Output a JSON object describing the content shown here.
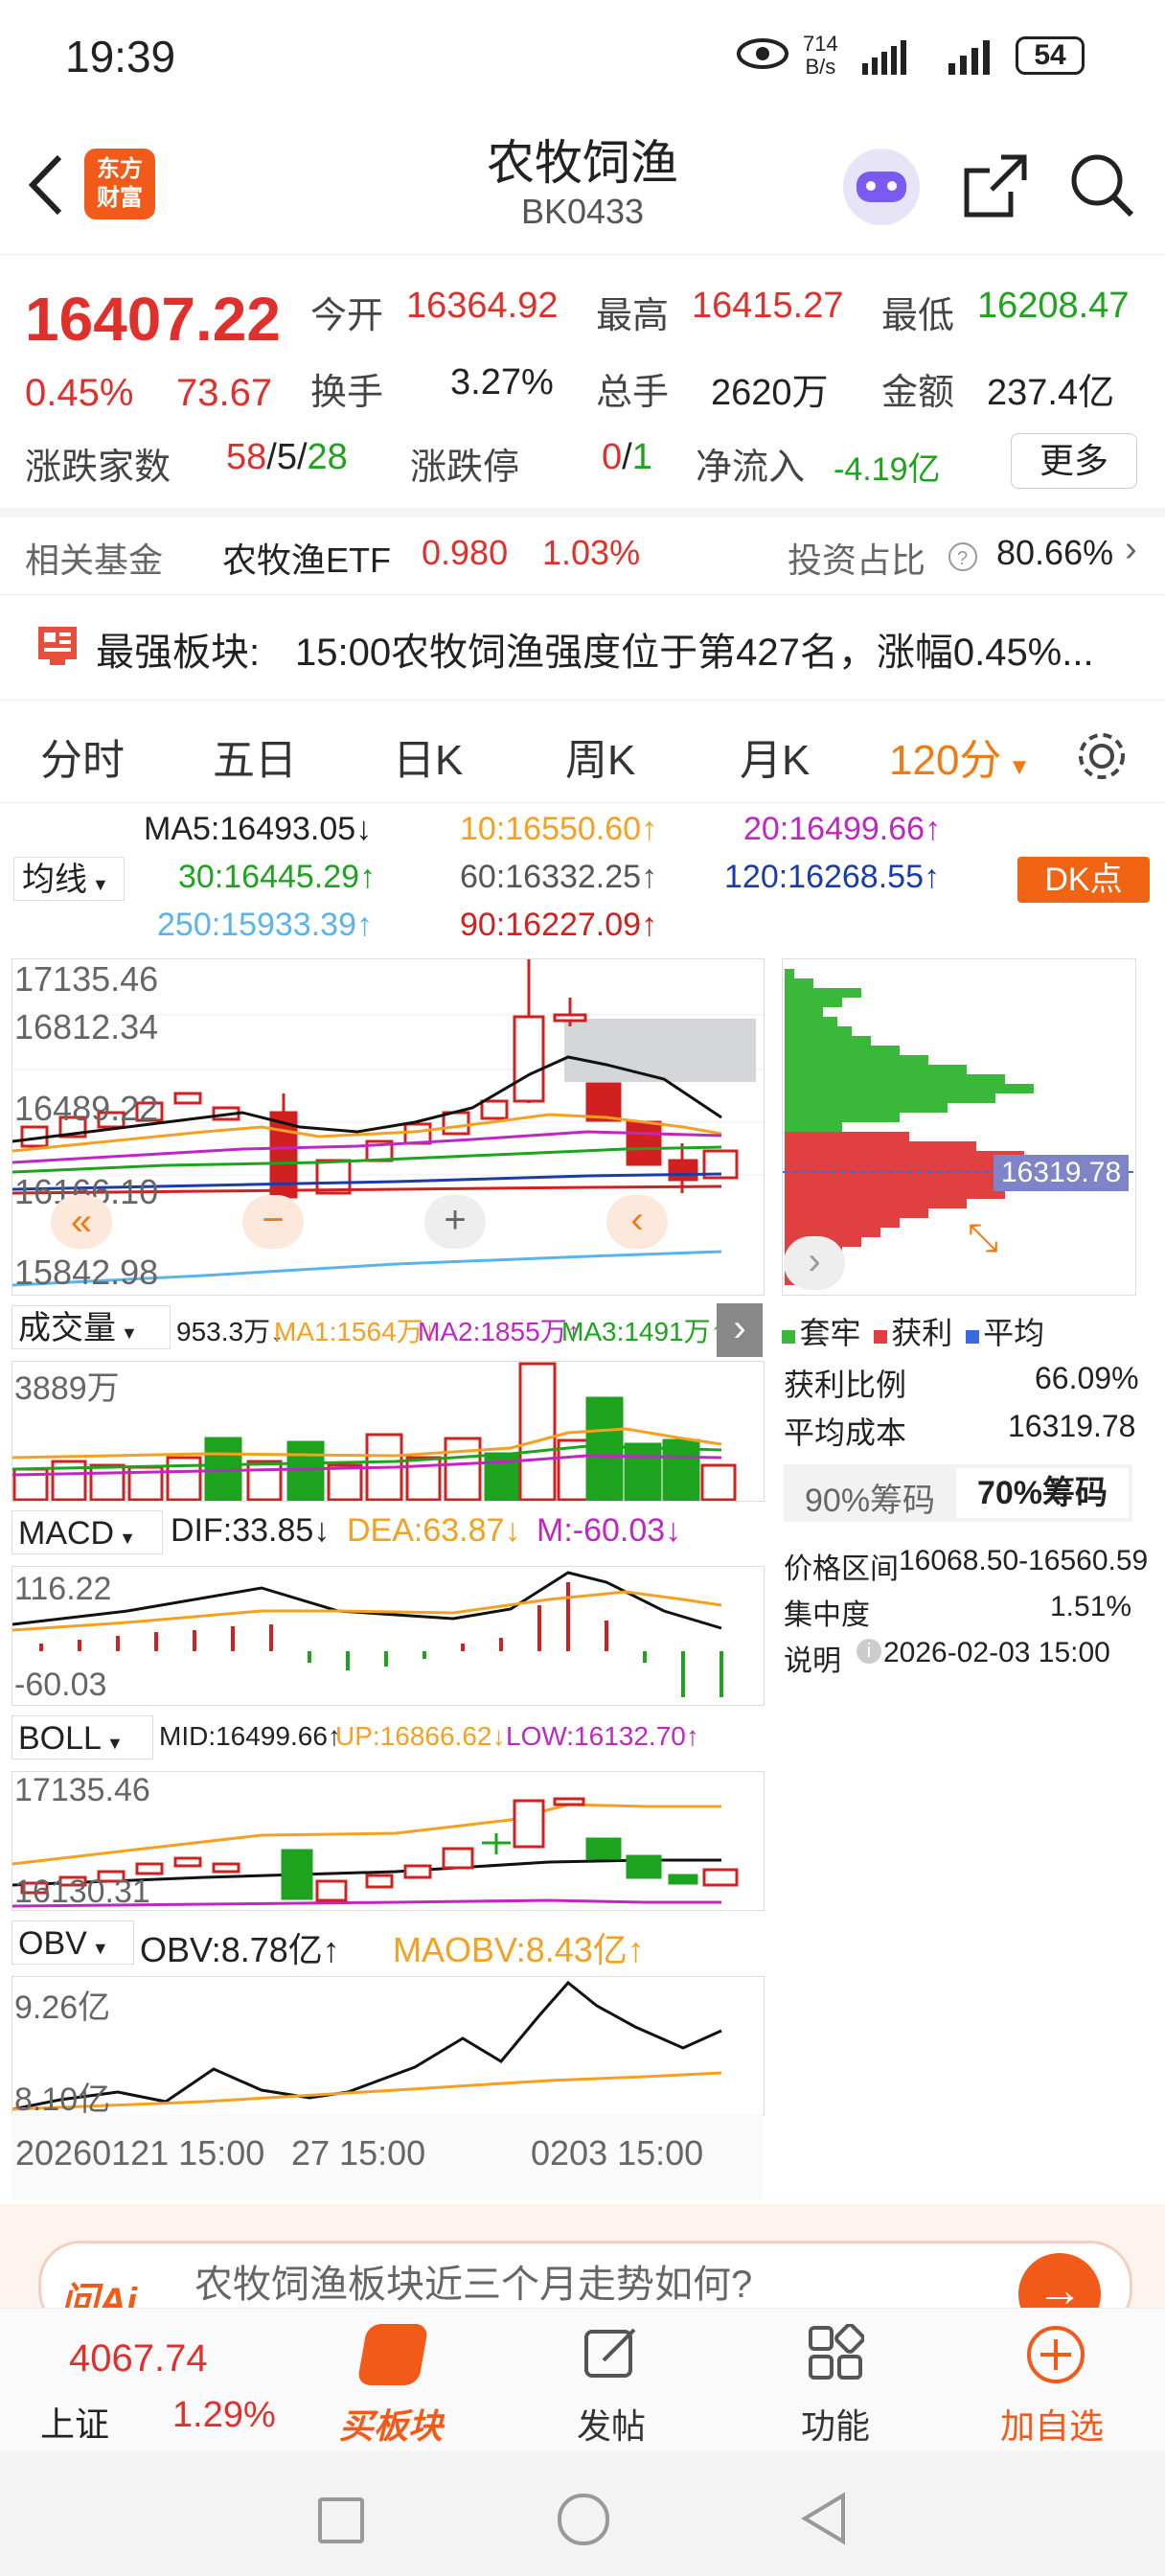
{
  "status_bar": {
    "time": "19:39",
    "net_speed": "714",
    "net_unit": "B/s",
    "battery": "54"
  },
  "header": {
    "logo_line1": "东方",
    "logo_line2": "财富",
    "title": "农牧饲渔",
    "code": "BK0433"
  },
  "quote": {
    "price": "16407.22",
    "change_pct": "0.45%",
    "change": "73.67",
    "open_label": "今开",
    "open": "16364.92",
    "high_label": "最高",
    "high": "16415.27",
    "low_label": "最低",
    "low": "16208.47",
    "turnover_label": "换手",
    "turnover": "3.27%",
    "volume_label": "总手",
    "volume": "2620万",
    "amount_label": "金额",
    "amount": "237.4亿",
    "counts_label": "涨跌家数",
    "up": "58",
    "flat": "5",
    "down": "28",
    "sep": "/",
    "limit_label": "涨跌停",
    "limit_up": "0",
    "limit_down": "1",
    "inflow_label": "净流入",
    "inflow": "-4.19亿",
    "more": "更多"
  },
  "fund": {
    "label": "相关基金",
    "name": "农牧渔ETF",
    "price": "0.980",
    "pct": "1.03%",
    "ratio_label": "投资占比",
    "ratio": "80.66%"
  },
  "news": {
    "title": "最强板块:",
    "text": "15:00农牧饲渔强度位于第427名，涨幅0.45%..."
  },
  "tabs": [
    "分时",
    "五日",
    "日K",
    "周K",
    "月K",
    "120分"
  ],
  "ma": {
    "select": "均线",
    "dk": "DK点",
    "ma5": "MA5:16493.05↓",
    "ma10": "10:16550.60↑",
    "ma20": "20:16499.66↑",
    "ma30": "30:16445.29↑",
    "ma60": "60:16332.25↑",
    "ma120": "120:16268.55↑",
    "ma250": "250:15933.39↑",
    "ma90": "90:16227.09↑"
  },
  "kline": {
    "y1": "17135.46",
    "y2": "16812.34",
    "y3": "16489.22",
    "y4": "16166.10",
    "y5": "15842.98"
  },
  "volume": {
    "select": "成交量",
    "v": "953.3万↓",
    "ma1": "MA1:1564万↓",
    "ma2": "MA2:1855万↑",
    "ma3": "MA3:1491万↑",
    "max": "3889万"
  },
  "macd": {
    "select": "MACD",
    "dif": "DIF:33.85↓",
    "dea": "DEA:63.87↓",
    "m": "M:-60.03↓",
    "top": "116.22",
    "bottom": "-60.03"
  },
  "boll": {
    "select": "BOLL",
    "mid": "MID:16499.66↑",
    "up": "UP:16866.62↓",
    "low": "LOW:16132.70↑",
    "top": "17135.46",
    "bottom": "16130.31"
  },
  "obv": {
    "select": "OBV",
    "obv": "OBV:8.78亿↑",
    "maobv": "MAOBV:8.43亿↑",
    "top": "9.26亿",
    "bottom": "8.10亿"
  },
  "xaxis": {
    "d1": "20260121 15:00",
    "d2": "27 15:00",
    "d3": "0203 15:00"
  },
  "chips": {
    "price_tag": "16319.78",
    "legend1": "套牢",
    "legend2": "获利",
    "legend3": "平均",
    "profit_label": "获利比例",
    "profit": "66.09%",
    "avgcost_label": "平均成本",
    "avgcost": "16319.78",
    "tab90": "90%筹码",
    "tab70": "70%筹码",
    "range_label": "价格区间",
    "range": "16068.50-16560.59",
    "conc_label": "集中度",
    "conc": "1.51%",
    "note_label": "说明",
    "note": "2026-02-03 15:00"
  },
  "ai": {
    "logo": "问Ai",
    "prompt": "农牧饲渔板块近三个月走势如何?"
  },
  "bottom": {
    "index_val": "4067.74",
    "index_name": "上证",
    "index_pct": "1.29%",
    "buy": "买板块",
    "post": "发帖",
    "func": "功能",
    "add": "加自选"
  },
  "colors": {
    "red": "#e0302c",
    "green": "#1ea31e",
    "orange": "#f5a020",
    "brand": "#f25a1a"
  }
}
